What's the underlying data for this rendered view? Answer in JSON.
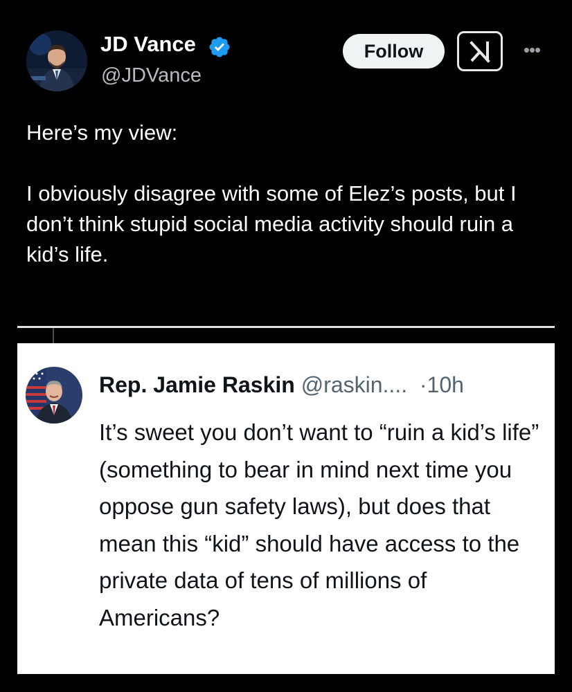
{
  "tweet": {
    "author": {
      "name": "JD Vance",
      "handle": "@JDVance",
      "verified": true
    },
    "follow_label": "Follow",
    "paragraphs": [
      "Here’s my view:",
      "I obviously disagree with some of Elez’s posts, but I don’t think stupid social media activity should ruin a kid’s life."
    ]
  },
  "reply": {
    "author": {
      "name": "Rep. Jamie Raskin",
      "handle": "@raskin....",
      "time": "10h"
    },
    "text": "It’s sweet you don’t want to “ruin a kid’s life” (something to bear in mind next time you oppose gun safety laws), but does that mean this “kid” should have access to the private data of tens of millions of Americans?"
  },
  "icons": {
    "verified": "verified-badge-icon",
    "grok": "grok-icon",
    "more": "more-options-icon"
  },
  "colors": {
    "background": "#000000",
    "verified_blue": "#1d9bf0",
    "follow_bg": "#eff3f4",
    "reply_bg": "#ffffff",
    "secondary_text": "#536471"
  }
}
